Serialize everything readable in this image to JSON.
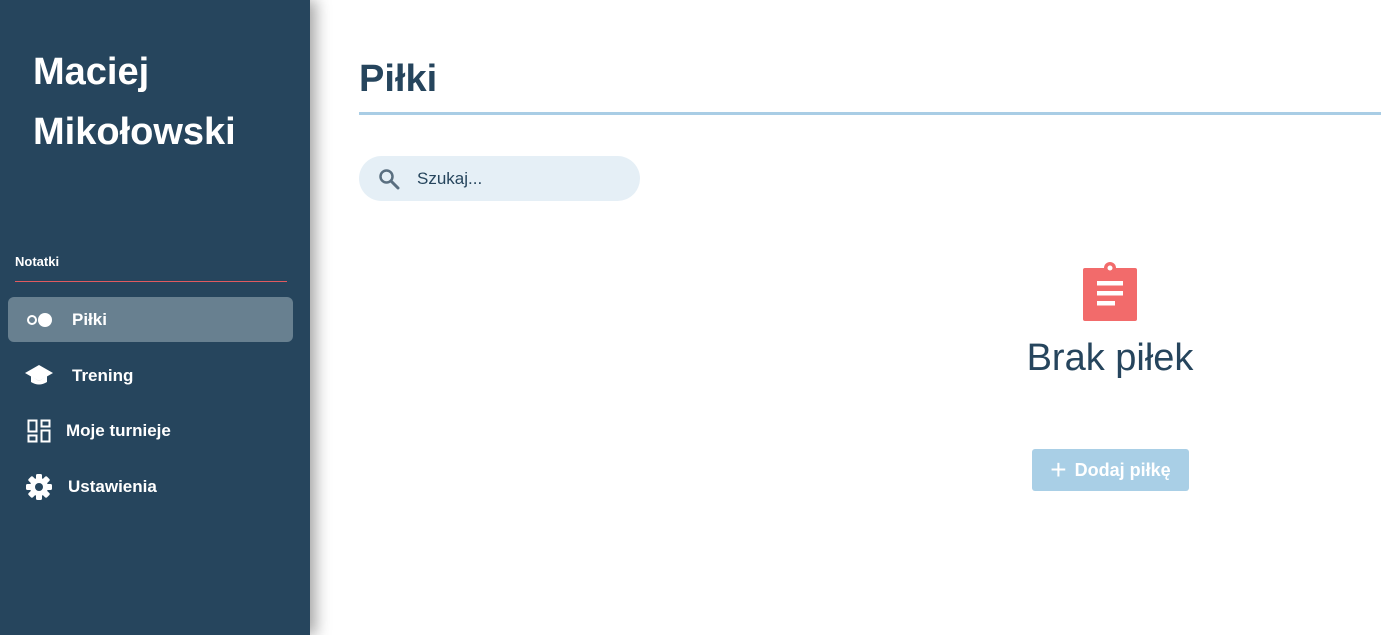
{
  "sidebar": {
    "user_name": "Maciej Mikołowski",
    "section_label": "Notatki",
    "items": [
      {
        "label": "Piłki",
        "icon": "balls-icon",
        "active": true
      },
      {
        "label": "Trening",
        "icon": "graduation-cap-icon",
        "active": false
      },
      {
        "label": "Moje turnieje",
        "icon": "dashboard-icon",
        "active": false
      },
      {
        "label": "Ustawienia",
        "icon": "gear-icon",
        "active": false
      }
    ]
  },
  "main": {
    "title": "Piłki",
    "search": {
      "placeholder": "Szukaj..."
    },
    "empty_state": {
      "icon": "clipboard-icon",
      "text": "Brak piłek"
    },
    "add_button_label": "Dodaj piłkę"
  },
  "colors": {
    "sidebar_bg": "#26455d",
    "active_item_bg": "#688090",
    "accent_line": "#e05a5f",
    "title_rule": "#a9cde5",
    "empty_icon": "#f26b6b",
    "add_button_bg": "#a9cfe6"
  }
}
